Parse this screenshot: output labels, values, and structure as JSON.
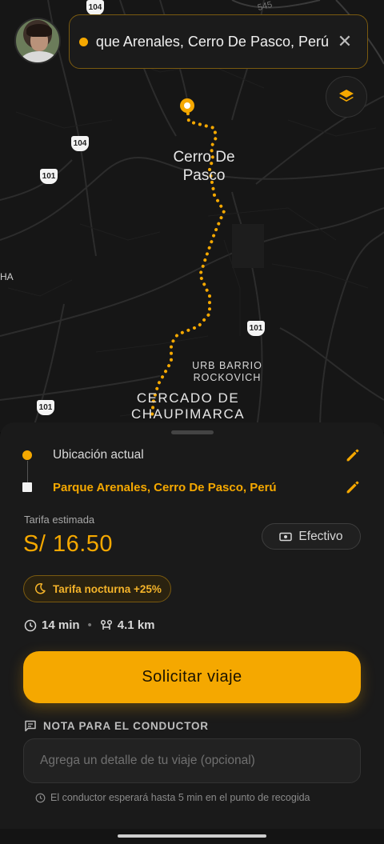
{
  "map": {
    "city_label_1": "Cerro De",
    "city_label_2": "Pasco",
    "urb_label_1": "URB BARRIO",
    "urb_label_2": "ROCKOVICH",
    "cercado_label_1": "CERCADO DE",
    "cercado_label_2": "CHAUPIMARCA",
    "edge_label": "HA",
    "road_shields": [
      "104",
      "104",
      "101",
      "101",
      "101"
    ],
    "road_top": "545"
  },
  "search": {
    "destination_text": "Parque Arenales, Cerro De Pasco, Perú",
    "close_icon": "close-icon"
  },
  "route": {
    "pickup_label": "Ubicación actual",
    "destination_label": "Parque Arenales, Cerro De Pasco, Perú"
  },
  "fare": {
    "label": "Tarifa estimada",
    "value": "S/ 16.50",
    "payment_method": "Efectivo",
    "night_badge": "Tarifa nocturna +25%"
  },
  "trip": {
    "duration": "14 min",
    "distance": "4.1 km"
  },
  "actions": {
    "request_label": "Solicitar viaje"
  },
  "note": {
    "title": "NOTA PARA EL CONDUCTOR",
    "placeholder": "Agrega un detalle de tu viaje (opcional)",
    "wait_info": "El conductor esperará hasta 5 min en el punto de recogida"
  },
  "colors": {
    "accent": "#f5a800",
    "background": "#0e0e0e",
    "sheet": "#1a1a1a"
  }
}
